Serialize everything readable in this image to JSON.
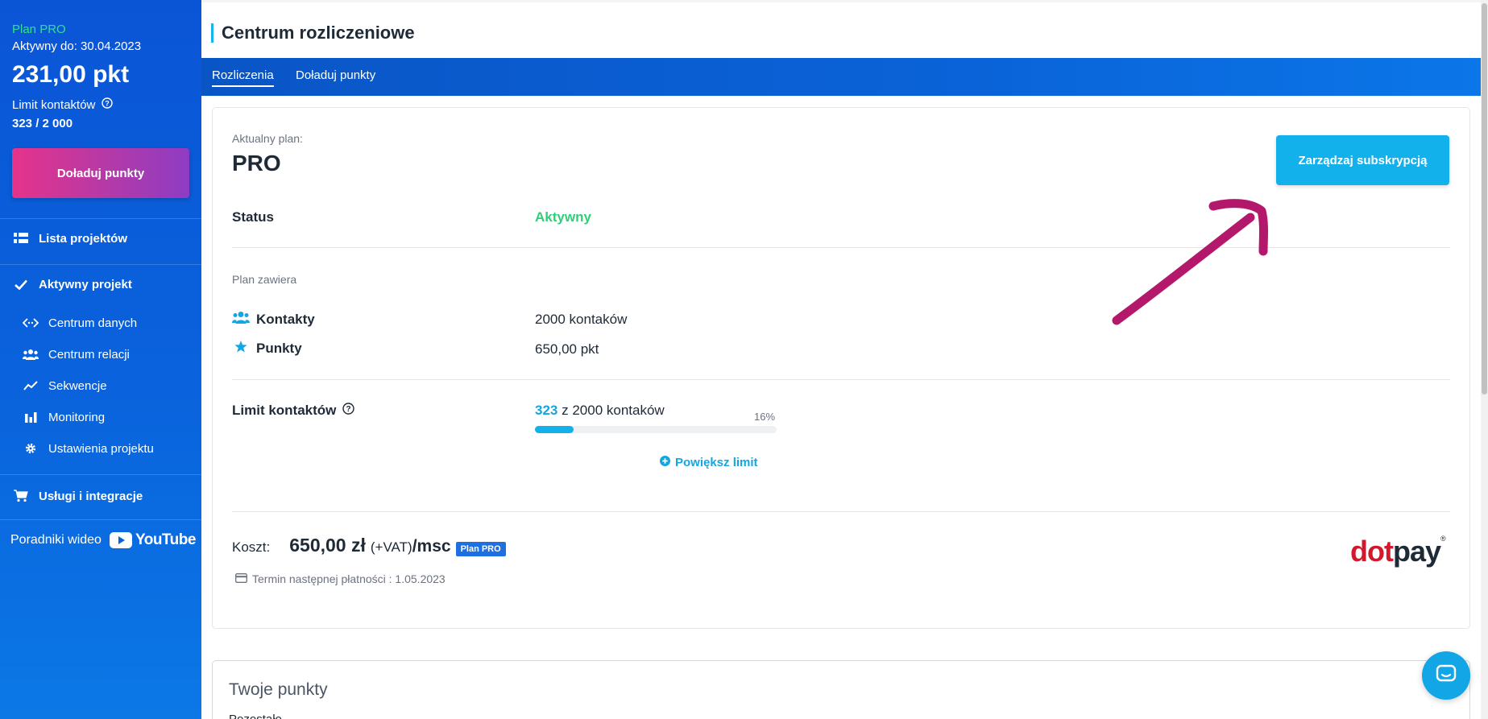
{
  "sidebar": {
    "plan_name": "Plan PRO",
    "active_until": "Aktywny do: 30.04.2023",
    "points": "231,00 pkt",
    "limit_label": "Limit kontaktów",
    "limit_value": "323 / 2 000",
    "topup_button": "Doładuj punkty",
    "projects_list": "Lista projektów",
    "active_project": "Aktywny projekt",
    "sub_items": [
      "Centrum danych",
      "Centrum relacji",
      "Sekwencje",
      "Monitoring",
      "Ustawienia projektu"
    ],
    "services": "Usługi i integracje",
    "video_guides": "Poradniki wideo",
    "youtube": "YouTube"
  },
  "header": {
    "title": "Centrum rozliczeniowe",
    "tabs": [
      "Rozliczenia",
      "Doładuj punkty"
    ]
  },
  "plan": {
    "current_label": "Aktualny plan:",
    "current_value": "PRO",
    "manage_button": "Zarządzaj subskrypcją",
    "status_label": "Status",
    "status_value": "Aktywny",
    "includes_label": "Plan zawiera",
    "contacts_label": "Kontakty",
    "contacts_value": "2000 kontaków",
    "points_label": "Punkty",
    "points_value": "650,00 pkt",
    "limit_label": "Limit kontaktów",
    "limit_used": "323",
    "limit_rest": "z 2000 kontaków",
    "limit_percent": "16%",
    "limit_fraction": 0.16,
    "increase_link": "Powiększ limit",
    "cost_label": "Koszt:",
    "cost_value": "650,00 zł",
    "vat": "(+VAT)",
    "per": "/msc",
    "badge": "Plan PRO",
    "next_payment": "Termin następnej płatności : 1.05.2023"
  },
  "points_card": {
    "title": "Twoje punkty",
    "subtitle": "Pozostało"
  },
  "brand": {
    "dotpay_red": "dot",
    "dotpay_dark": "pay",
    "dotpay_mark": "®"
  },
  "colors": {
    "accent": "#13b1ec",
    "active_green": "#2fcf7a",
    "arrow": "#b3186b"
  }
}
